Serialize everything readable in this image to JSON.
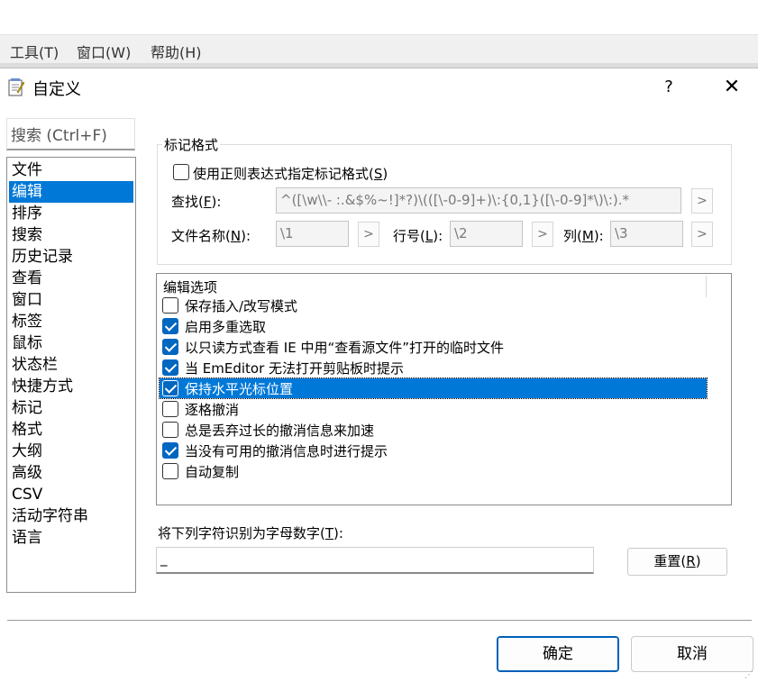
{
  "app_menu": [
    {
      "label": "工具(T)"
    },
    {
      "label": "窗口(W)"
    },
    {
      "label": "帮助(H)"
    }
  ],
  "dialog": {
    "title": "自定义",
    "help_label": "?",
    "close_label": "✕"
  },
  "search": {
    "placeholder": "搜索 (Ctrl+F)"
  },
  "categories": [
    "文件",
    "编辑",
    "排序",
    "搜索",
    "历史记录",
    "查看",
    "窗口",
    "标签",
    "鼠标",
    "状态栏",
    "快捷方式",
    "标记",
    "格式",
    "大纲",
    "高级",
    "CSV",
    "活动字符串",
    "语言"
  ],
  "selected_category": "编辑",
  "marker_format": {
    "group_title": "标记格式",
    "regex_checkbox": {
      "label": "使用正则表达式指定标记格式(S)",
      "checked": false
    },
    "find_label": "查找(F):",
    "find_value": "^([\\w\\\\- :.&$%~!]*?)\\(([\\-0-9]+)\\:{0,1}([\\-0-9]*\\)\\:).*",
    "filename_label": "文件名称(N):",
    "filename_value": "\\1",
    "line_label": "行号(L):",
    "line_value": "\\2",
    "column_label": "列(M):",
    "column_value": "\\3",
    "arrow": ">"
  },
  "edit_options": {
    "header": "编辑选项",
    "items": [
      {
        "label": "保存插入/改写模式",
        "checked": false,
        "selected": false
      },
      {
        "label": "启用多重选取",
        "checked": true,
        "selected": false
      },
      {
        "label": "以只读方式查看 IE 中用“查看源文件”打开的临时文件",
        "checked": true,
        "selected": false
      },
      {
        "label": "当 EmEditor 无法打开剪贴板时提示",
        "checked": true,
        "selected": false
      },
      {
        "label": "保持水平光标位置",
        "checked": true,
        "selected": true
      },
      {
        "label": "逐格撤消",
        "checked": false,
        "selected": false
      },
      {
        "label": "总是丢弃过长的撤消信息来加速",
        "checked": false,
        "selected": false
      },
      {
        "label": "当没有可用的撤消信息时进行提示",
        "checked": true,
        "selected": false
      },
      {
        "label": "自动复制",
        "checked": false,
        "selected": false
      }
    ]
  },
  "alnum": {
    "label": "将下列字符识别为字母数字(T):",
    "value": "_",
    "reset_label": "重置(R)"
  },
  "footer": {
    "ok_label": "确定",
    "cancel_label": "取消"
  }
}
